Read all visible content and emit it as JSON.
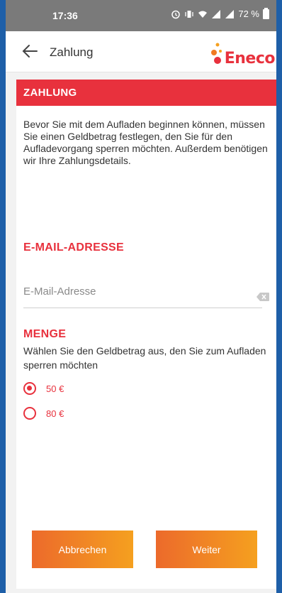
{
  "status_bar": {
    "time": "17:36",
    "battery": "72 %"
  },
  "app_bar": {
    "title": "Zahlung",
    "logo_text": "Eneco",
    "brand_color": "#e8313d"
  },
  "card": {
    "header": "ZAHLUNG",
    "intro": "Bevor Sie mit dem Aufladen beginnen können, müssen Sie einen Geldbetrag festlegen, den Sie für den Aufladevorgang sperren möchten. Außerdem benötigen wir Ihre Zahlungsdetails.",
    "email_heading": "E-MAIL-ADRESSE",
    "email_field": {
      "placeholder": "E-Mail-Adresse",
      "value": ""
    },
    "amount_heading": "MENGE",
    "amount_description": "Wählen Sie den Geldbetrag aus, den Sie zum Aufladen sperren möchten",
    "amount_options": [
      {
        "label": "50 €",
        "selected": true
      },
      {
        "label": "80 €",
        "selected": false
      }
    ]
  },
  "buttons": {
    "cancel": "Abbrechen",
    "next": "Weiter"
  },
  "icons": [
    "alarm-icon",
    "vibrate-icon",
    "wifi-icon",
    "signal-icon",
    "battery-icon",
    "back-arrow-icon",
    "clear-icon"
  ]
}
